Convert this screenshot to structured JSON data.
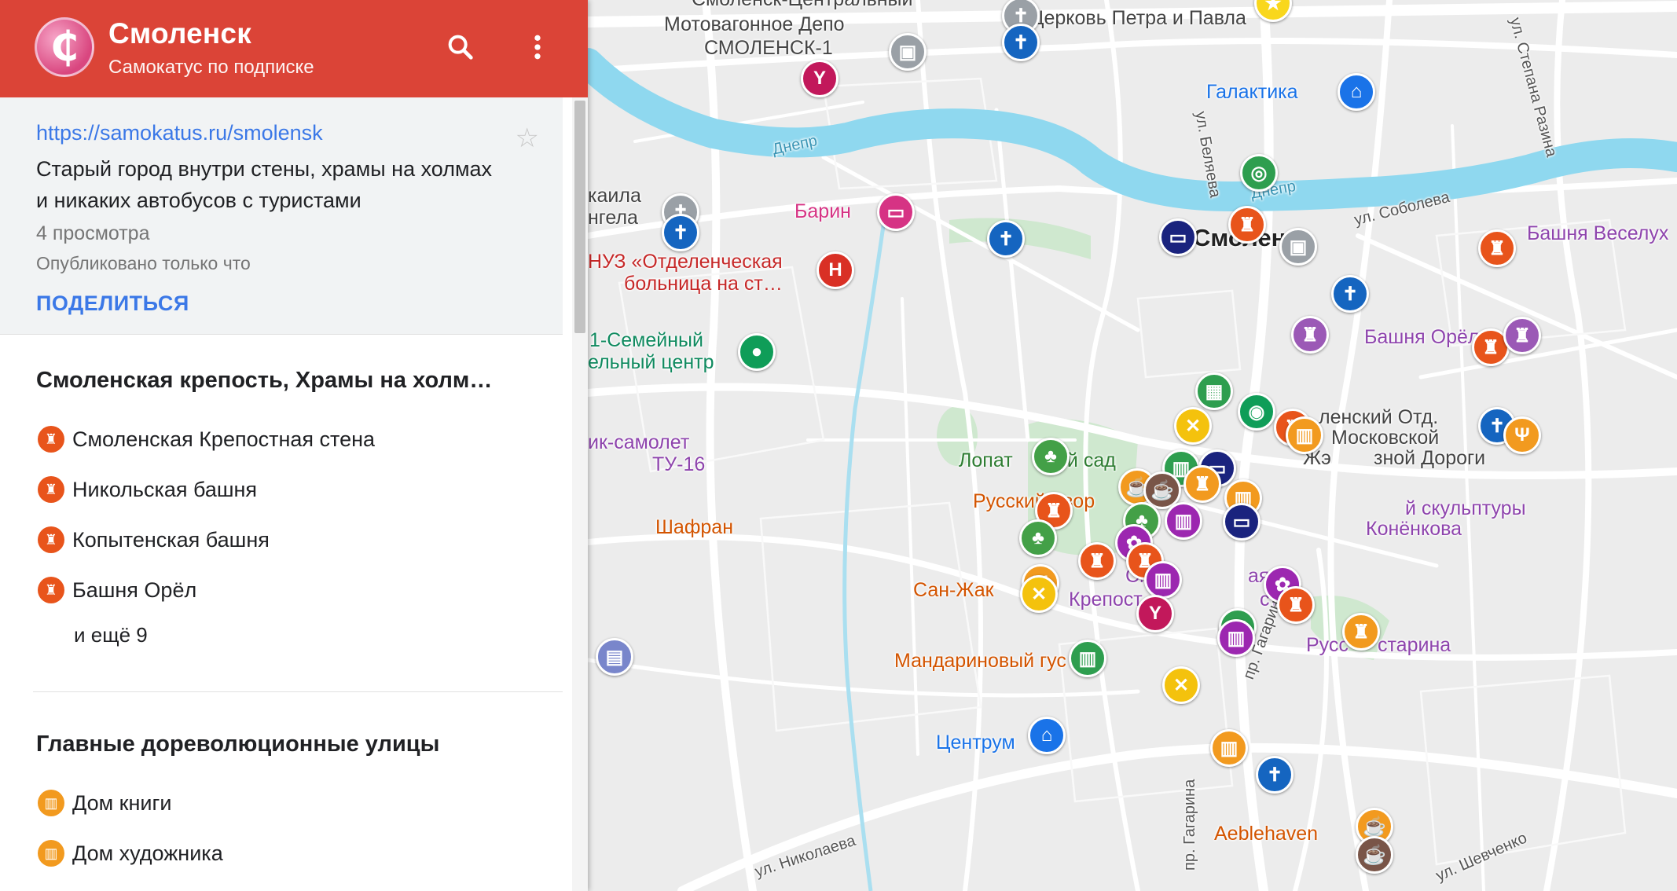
{
  "header": {
    "logo_glyph": "₵",
    "title": "Смоленск",
    "subtitle": "Самокатус по подписке",
    "icons": [
      "search-icon",
      "more-vert-icon"
    ]
  },
  "info": {
    "link": "https://samokatus.ru/smolensk",
    "description": "Старый город внутри стены, храмы на холмах и никаких автобусов с туристами",
    "views": "4 просмотра",
    "published": "Опубликовано только что",
    "share_label": "ПОДЕЛИТЬСЯ"
  },
  "layers": [
    {
      "title": "Смоленская крепость, Храмы на холм…",
      "icon_color": "#e8541b",
      "items": [
        {
          "label": "Смоленская Крепостная стена"
        },
        {
          "label": "Никольская башня"
        },
        {
          "label": "Копытенская башня"
        },
        {
          "label": "Башня Орёл"
        }
      ],
      "more": "и ещё 9"
    },
    {
      "title": "Главные дореволюционные улицы",
      "icon_color": "#f29a1f",
      "items": [
        {
          "label": "Дом книги"
        },
        {
          "label": "Дом художника"
        }
      ]
    }
  ],
  "map": {
    "colors": {
      "river": "#8fd8ef",
      "park": "#c8e6c9",
      "road": "#ffffff",
      "background": "#ececec"
    },
    "labels": [
      {
        "text": "Мотовагонное Депо",
        "color": "#444444"
      },
      {
        "text": "СМОЛЕНСК-1",
        "color": "#444444"
      },
      {
        "text": "Церковь Петра и Павла",
        "color": "#444444"
      },
      {
        "text": "Галактика",
        "color": "#1a73e8"
      },
      {
        "text": "Днепр",
        "color": "#3a95b5"
      },
      {
        "text": "Днепр",
        "color": "#3a95b5"
      },
      {
        "text": "ул. Беляева",
        "color": "#555555"
      },
      {
        "text": "ул. Степана Разина",
        "color": "#555555"
      },
      {
        "text": "ул. Соболева",
        "color": "#555555"
      },
      {
        "text": "Башня Веселух",
        "color": "#8e44ad"
      },
      {
        "text": "Барин",
        "color": "#d63384"
      },
      {
        "text": "каила",
        "color": "#444444"
      },
      {
        "text": "нгела",
        "color": "#444444"
      },
      {
        "text": "НУЗ «Отделенческая",
        "color": "#c62828"
      },
      {
        "text": "больница на ст…",
        "color": "#c62828"
      },
      {
        "text": "1-Семейный",
        "color": "#0f8a5f"
      },
      {
        "text": "ельный центр",
        "color": "#0f8a5f"
      },
      {
        "text": "Смоленск",
        "color": "#222222"
      },
      {
        "text": "Башня Орёл",
        "color": "#8e44ad"
      },
      {
        "text": "ленский Отд.",
        "color": "#444444"
      },
      {
        "text": "Московской",
        "color": "#444444"
      },
      {
        "text": "Жэ",
        "color": "#444444"
      },
      {
        "text": "зной Дороги",
        "color": "#444444"
      },
      {
        "text": "ик-самолет",
        "color": "#8e44ad"
      },
      {
        "text": "ТУ-16",
        "color": "#8e44ad"
      },
      {
        "text": "Лопат",
        "color": "#2e7d32"
      },
      {
        "text": "кий сад",
        "color": "#2e7d32"
      },
      {
        "text": "Русский двор",
        "color": "#d35400"
      },
      {
        "text": "й скульптуры",
        "color": "#8e44ad"
      },
      {
        "text": "Конёнкова",
        "color": "#8e44ad"
      },
      {
        "text": "Шафран",
        "color": "#d35400"
      },
      {
        "text": "Сан-Жак",
        "color": "#d35400"
      },
      {
        "text": "Смо",
        "color": "#8e44ad"
      },
      {
        "text": "ая",
        "color": "#8e44ad"
      },
      {
        "text": "Крепост",
        "color": "#8e44ad"
      },
      {
        "text": "стена",
        "color": "#8e44ad"
      },
      {
        "text": "Русс",
        "color": "#8e44ad"
      },
      {
        "text": "старина",
        "color": "#8e44ad"
      },
      {
        "text": "Мандариновый гус",
        "color": "#d35400"
      },
      {
        "text": "пр. Гагарина",
        "color": "#555555"
      },
      {
        "text": "пр. Гагарина",
        "color": "#555555"
      },
      {
        "text": "Центрум",
        "color": "#1a73e8"
      },
      {
        "text": "ул. Николаева",
        "color": "#555555"
      },
      {
        "text": "Aeblehaven",
        "color": "#d35400"
      },
      {
        "text": "ул. Шевченко",
        "color": "#555555"
      },
      {
        "text": "Смоленск-Центральный",
        "color": "#444444"
      }
    ],
    "pins": [
      {
        "icon": "church-icon",
        "color": "#9aa0a6",
        "glyph": "✝"
      },
      {
        "icon": "church-icon",
        "color": "#1565c0",
        "glyph": "✝"
      },
      {
        "icon": "museum-icon",
        "color": "#f9d71c",
        "glyph": "★"
      },
      {
        "icon": "train-icon",
        "color": "#9aa0a6",
        "glyph": "▣"
      },
      {
        "icon": "bar-icon",
        "color": "#c2185b",
        "glyph": "Y"
      },
      {
        "icon": "shopping-icon",
        "color": "#1a73e8",
        "glyph": "⌂"
      },
      {
        "icon": "binoculars-icon",
        "color": "#2e9e4f",
        "glyph": "◎"
      },
      {
        "icon": "church-icon",
        "color": "#9aa0a6",
        "glyph": "✝"
      },
      {
        "icon": "church-icon",
        "color": "#1565c0",
        "glyph": "✝"
      },
      {
        "icon": "hotel-icon",
        "color": "#d63384",
        "glyph": "▭"
      },
      {
        "icon": "church-icon",
        "color": "#1565c0",
        "glyph": "✝"
      },
      {
        "icon": "hospital-icon",
        "color": "#d93025",
        "glyph": "H"
      },
      {
        "icon": "hotel-icon",
        "color": "#1a237e",
        "glyph": "▭"
      },
      {
        "icon": "castle-icon",
        "color": "#e8541b",
        "glyph": "♜"
      },
      {
        "icon": "castle-icon",
        "color": "#e8541b",
        "glyph": "♜"
      },
      {
        "icon": "castle-icon",
        "color": "#e8541b",
        "glyph": "♜"
      },
      {
        "icon": "church-icon",
        "color": "#1565c0",
        "glyph": "✝"
      },
      {
        "icon": "circle-icon",
        "color": "#0f9d58",
        "glyph": "●"
      },
      {
        "icon": "landmark-icon",
        "color": "#9b59b6",
        "glyph": "♜"
      },
      {
        "icon": "landmark-icon",
        "color": "#9b59b6",
        "glyph": "♜"
      },
      {
        "icon": "city-icon",
        "color": "#2e9e4f",
        "glyph": "▦"
      },
      {
        "icon": "restaurant-icon",
        "color": "#f4c20d",
        "glyph": "✕"
      },
      {
        "icon": "camera-icon",
        "color": "#0f9d58",
        "glyph": "◉"
      },
      {
        "icon": "church-icon",
        "color": "#1565c0",
        "glyph": "✝"
      },
      {
        "icon": "castle-icon",
        "color": "#e8541b",
        "glyph": "♜"
      },
      {
        "icon": "museum-icon",
        "color": "#f29a1f",
        "glyph": "▥"
      },
      {
        "icon": "park-icon",
        "color": "#43a047",
        "glyph": "♣"
      },
      {
        "icon": "museum-icon",
        "color": "#2e9e4f",
        "glyph": "▥"
      },
      {
        "icon": "hotel-icon",
        "color": "#1a237e",
        "glyph": "▭"
      },
      {
        "icon": "restaurant-icon",
        "color": "#f29a1f",
        "glyph": "Ψ"
      },
      {
        "icon": "cafe-icon",
        "color": "#f29a1f",
        "glyph": "☕"
      },
      {
        "icon": "cafe-icon",
        "color": "#795548",
        "glyph": "☕"
      },
      {
        "icon": "museum-icon",
        "color": "#f29a1f",
        "glyph": "▥"
      },
      {
        "icon": "castle-icon",
        "color": "#e8541b",
        "glyph": "♜"
      },
      {
        "icon": "park-icon",
        "color": "#43a047",
        "glyph": "♣"
      },
      {
        "icon": "park-icon",
        "color": "#43a047",
        "glyph": "♣"
      },
      {
        "icon": "museum-icon",
        "color": "#9c27b0",
        "glyph": "▥"
      },
      {
        "icon": "hotel-icon",
        "color": "#1a237e",
        "glyph": "▭"
      },
      {
        "icon": "art-icon",
        "color": "#9c27b0",
        "glyph": "✿"
      },
      {
        "icon": "castle-icon",
        "color": "#e8541b",
        "glyph": "♜"
      },
      {
        "icon": "castle-icon",
        "color": "#f29a1f",
        "glyph": "♜"
      },
      {
        "icon": "museum-icon",
        "color": "#9c27b0",
        "glyph": "▥"
      },
      {
        "icon": "castle-icon",
        "color": "#e8541b",
        "glyph": "♜"
      },
      {
        "icon": "restaurant-icon",
        "color": "#f29a1f",
        "glyph": "Ψ"
      },
      {
        "icon": "restaurant-icon",
        "color": "#f4c20d",
        "glyph": "✕"
      },
      {
        "icon": "bar-icon",
        "color": "#c2185b",
        "glyph": "Y"
      },
      {
        "icon": "art-icon",
        "color": "#9c27b0",
        "glyph": "✿"
      },
      {
        "icon": "castle-icon",
        "color": "#e8541b",
        "glyph": "♜"
      },
      {
        "icon": "museum-icon",
        "color": "#2e9e4f",
        "glyph": "▥"
      },
      {
        "icon": "museum-icon",
        "color": "#9c27b0",
        "glyph": "▥"
      },
      {
        "icon": "castle-icon",
        "color": "#f29a1f",
        "glyph": "♜"
      },
      {
        "icon": "museum-icon",
        "color": "#2e9e4f",
        "glyph": "▥"
      },
      {
        "icon": "restaurant-icon",
        "color": "#f4c20d",
        "glyph": "✕"
      },
      {
        "icon": "shopping-icon",
        "color": "#1a73e8",
        "glyph": "⌂"
      },
      {
        "icon": "museum-icon",
        "color": "#f29a1f",
        "glyph": "▥"
      },
      {
        "icon": "church-icon",
        "color": "#1565c0",
        "glyph": "✝"
      },
      {
        "icon": "cafe-icon",
        "color": "#f29a1f",
        "glyph": "☕"
      },
      {
        "icon": "cafe-icon",
        "color": "#795548",
        "glyph": "☕"
      },
      {
        "icon": "bus-icon",
        "color": "#7986cb",
        "glyph": "▤"
      },
      {
        "icon": "train-icon",
        "color": "#9aa0a6",
        "glyph": "▣"
      }
    ]
  }
}
